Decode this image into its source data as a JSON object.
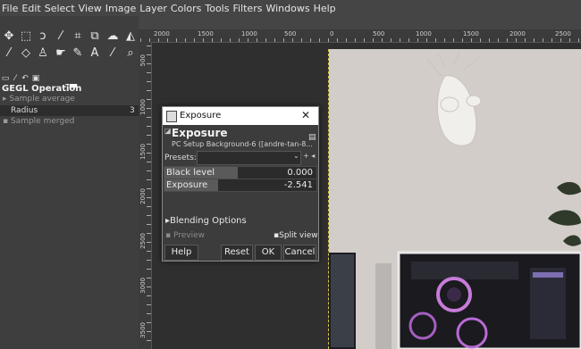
{
  "menubar": [
    "File",
    "Edit",
    "Select",
    "View",
    "Image",
    "Layer",
    "Colors",
    "Tools",
    "Filters",
    "Windows",
    "Help"
  ],
  "ruler": {
    "h_labels": [
      "2000",
      "1500",
      "1000",
      "500",
      "0",
      "500",
      "1000",
      "1500",
      "2000",
      "2500"
    ],
    "v_labels": [
      "500",
      "1000",
      "1500",
      "2000",
      "2500",
      "3000",
      "3500"
    ]
  },
  "tool_options": {
    "title": "GEGL Operation",
    "sample_average": "Sample average",
    "radius_label": "Radius",
    "radius_value": "3",
    "sample_merged": "Sample merged"
  },
  "dialog": {
    "window_title": "Exposure",
    "heading": "Exposure",
    "subtitle": "PC Setup Background-6 ([andre-tan-8...",
    "presets_label": "Presets:",
    "black_level_label": "Black level",
    "black_level_value": "0.000",
    "exposure_label": "Exposure",
    "exposure_value": "-2.541",
    "blending_options": "Blending Options",
    "preview": "Preview",
    "split_view": "Split view",
    "buttons": {
      "help": "Help",
      "reset": "Reset",
      "ok": "OK",
      "cancel": "Cancel"
    }
  }
}
